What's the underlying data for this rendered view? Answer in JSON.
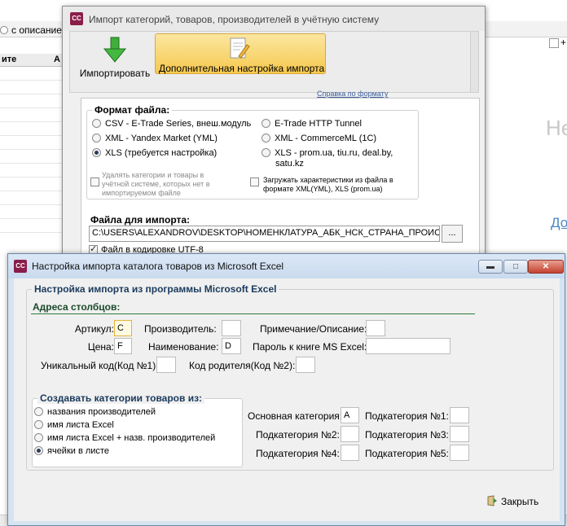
{
  "background_app": {
    "radio_with_description": "с описанием",
    "grid_header_1": "ите",
    "grid_header_2": "А",
    "right_plus": "+",
    "right_text_ne": "Не",
    "right_link_do": "До"
  },
  "import_dialog": {
    "title": "Импорт категорий, товаров, производителей в учётную систему",
    "app_icon": "CC",
    "ribbon": {
      "import_button": "Импортировать",
      "extra_settings_button": "Дополнительная настройка импорта"
    },
    "help_link": "Справка по формату",
    "file_format": {
      "group_label": "Формат файла:",
      "options": [
        {
          "label": "CSV - E-Trade Series, внеш.модуль",
          "selected": false
        },
        {
          "label": "XML - Yandex Market (YML)",
          "selected": false
        },
        {
          "label": "XLS (требуется настройка)",
          "selected": true
        },
        {
          "label": "E-Trade HTTP Tunnel",
          "selected": false
        },
        {
          "label": "XML - CommerceML (1C)",
          "selected": false
        },
        {
          "label": "XLS - prom.ua, tiu.ru, deal.by,",
          "label2": "satu.kz",
          "selected": false
        }
      ],
      "delete_missing_checkbox_lines": [
        "Удалять категории и товары в",
        "учётной системе, которых нет в",
        "импортируемом файле"
      ],
      "load_attributes_checkbox_lines": [
        "Загружать характеристики из файла в",
        "формате XML(YML), XLS (prom.ua)"
      ]
    },
    "import_file": {
      "group_label": "Файла для импорта:",
      "path_value": "C:\\USERS\\ALEXANDROV\\DESKTOP\\НОМЕНКЛАТУРА_АБК_НСК_СТРАНА_ПРОИСХОЖД",
      "browse_button": "...",
      "utf8_checkbox": "Файл в кодировке UTF-8",
      "utf8_checked": true
    }
  },
  "excel_dialog": {
    "title": "Настройка импорта каталога товаров из Microsoft Excel",
    "app_icon": "CC",
    "window_buttons": {
      "minimize": "▬",
      "maximize": "□",
      "close": "✕"
    },
    "main_group_label": "Настройка импорта из программы Microsoft Excel",
    "columns_section": "Адреса столбцов:",
    "fields": {
      "article": {
        "label": "Артикул:",
        "value": "C"
      },
      "manufacturer": {
        "label": "Производитель:",
        "value": ""
      },
      "note": {
        "label": "Примечание/Описание:",
        "value": ""
      },
      "price": {
        "label": "Цена:",
        "value": "F"
      },
      "name": {
        "label": "Наименование:",
        "value": "D"
      },
      "password": {
        "label": "Пароль к книге MS Excel:",
        "value": ""
      },
      "unique_code": {
        "label": "Уникальный код(Код №1):",
        "value": ""
      },
      "parent_code": {
        "label": "Код родителя(Код №2):",
        "value": ""
      }
    },
    "categories_group": {
      "label": "Создавать категории товаров из:",
      "options": [
        {
          "label": "названия производителей",
          "selected": false
        },
        {
          "label": "имя листа Excel",
          "selected": false
        },
        {
          "label": "имя листа Excel + назв. производителей",
          "selected": false
        },
        {
          "label": "ячейки в листе",
          "selected": true
        }
      ]
    },
    "category_cells": {
      "main": {
        "label": "Основная категория:",
        "value": "A"
      },
      "sub1": {
        "label": "Подкатегория №1:",
        "value": ""
      },
      "sub2": {
        "label": "Подкатегория №2:",
        "value": ""
      },
      "sub3": {
        "label": "Подкатегория №3:",
        "value": ""
      },
      "sub4": {
        "label": "Подкатегория №4:",
        "value": ""
      },
      "sub5": {
        "label": "Подкатегория №5:",
        "value": ""
      }
    },
    "close_button": "Закрыть"
  },
  "colors": {
    "accent_green": "#2e7a3a",
    "ribbon_highlight": "#f6c94e",
    "app_icon_bg": "#8b1d4a",
    "dialog_frame": "#d6e3f1"
  }
}
